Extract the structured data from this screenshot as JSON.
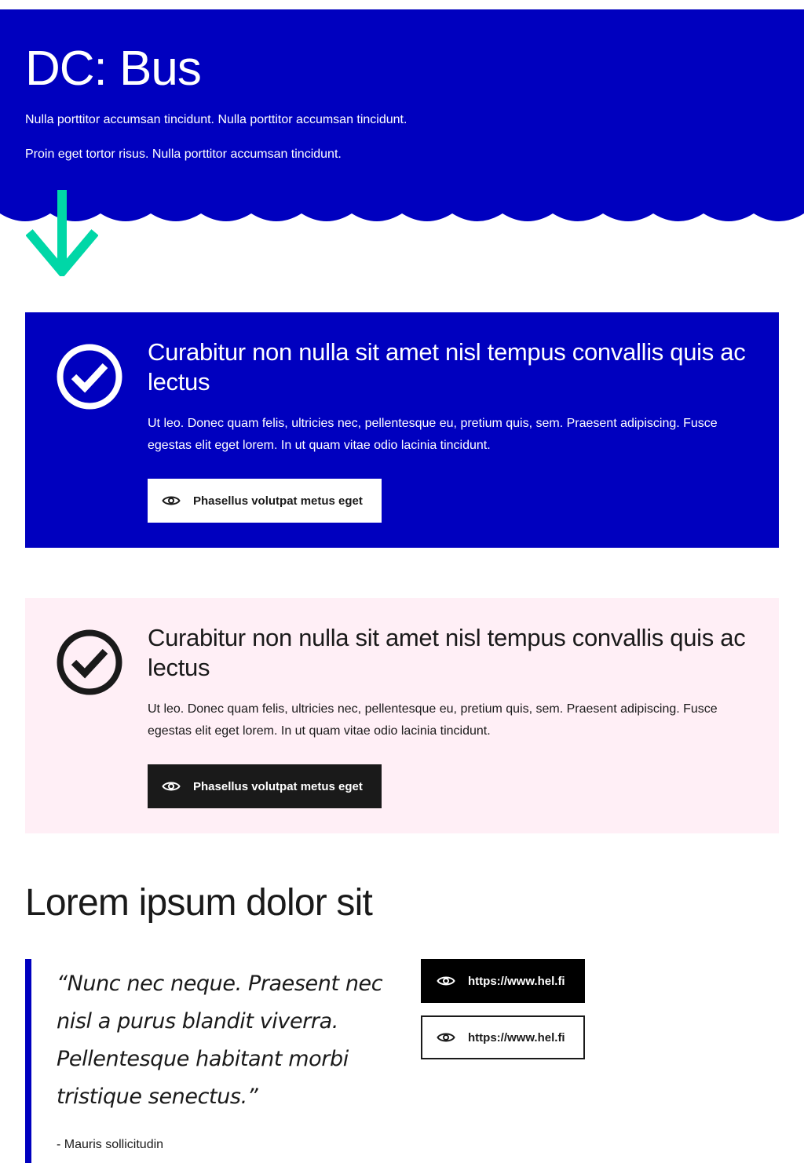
{
  "hero": {
    "title": "DC: Bus",
    "paragraphs": [
      "Nulla porttitor accumsan tincidunt. Nulla porttitor accumsan tincidunt.",
      "Proin eget tortor risus. Nulla porttitor accumsan tincidunt."
    ]
  },
  "scroll_arrow": {
    "icon": "arrow-down-icon",
    "color": "#00d7a7"
  },
  "cards": [
    {
      "variant": "blue",
      "icon": "check-circle-icon",
      "title": "Curabitur non nulla sit amet nisl tempus convallis quis ac lectus",
      "text": "Ut leo. Donec quam felis, ultricies nec, pellentesque eu, pretium quis, sem. Praesent adipiscing. Fusce egestas elit eget lorem. In ut quam vitae odio lacinia tincidunt.",
      "button": {
        "icon": "eye-icon",
        "label": "Phasellus volutpat metus eget"
      }
    },
    {
      "variant": "pink",
      "icon": "check-circle-icon",
      "title": "Curabitur non nulla sit amet nisl tempus convallis quis ac lectus",
      "text": "Ut leo. Donec quam felis, ultricies nec, pellentesque eu, pretium quis, sem. Praesent adipiscing. Fusce egestas elit eget lorem. In ut quam vitae odio lacinia tincidunt.",
      "button": {
        "icon": "eye-icon",
        "label": "Phasellus volutpat metus eget"
      }
    }
  ],
  "section": {
    "title": "Lorem ipsum dolor sit",
    "quote": {
      "text": "“Nunc nec neque. Praesent nec nisl a purus blandit viverra. Pellentesque habitant morbi tristique senectus.”",
      "author": "- Mauris sollicitudin"
    },
    "links": [
      {
        "style": "dark",
        "icon": "eye-icon",
        "label": "https://www.hel.fi"
      },
      {
        "style": "light",
        "icon": "eye-icon",
        "label": "https://www.hel.fi"
      }
    ]
  },
  "colors": {
    "brand_blue": "#0000bf",
    "accent_green": "#00d7a7",
    "pink_bg": "#ffeff6",
    "dark": "#1a1a1a"
  }
}
